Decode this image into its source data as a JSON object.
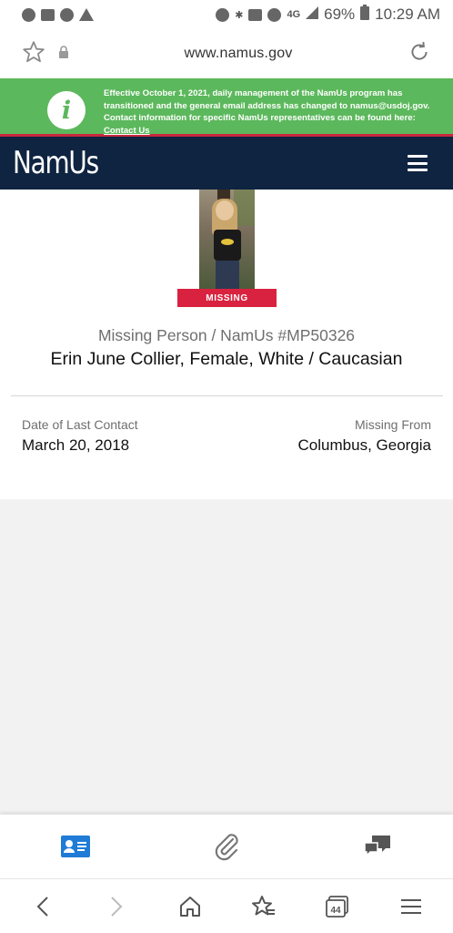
{
  "status_bar": {
    "battery": "69%",
    "time": "10:29 AM",
    "network": "4G"
  },
  "url_bar": {
    "url": "www.namus.gov"
  },
  "notice": {
    "text": "Effective October 1, 2021, daily management of the NamUs program has transitioned and the general email address has changed to namus@usdoj.gov. Contact information for specific NamUs representatives can be found here: ",
    "link_label": "Contact Us"
  },
  "header": {
    "logo": "NamUs"
  },
  "case": {
    "badge": "MISSING",
    "case_id": "Missing Person / NamUs #MP50326",
    "name": "Erin June Collier, Female, White / Caucasian",
    "last_contact_label": "Date of Last Contact",
    "last_contact_value": "March 20, 2018",
    "missing_from_label": "Missing From",
    "missing_from_value": "Columbus, Georgia"
  },
  "browser_nav": {
    "tab_count": "44"
  },
  "colors": {
    "accent_blue": "#1f7bd6",
    "header_navy": "#0f2440",
    "notice_green": "#5cb85c",
    "badge_red": "#d9223f"
  }
}
